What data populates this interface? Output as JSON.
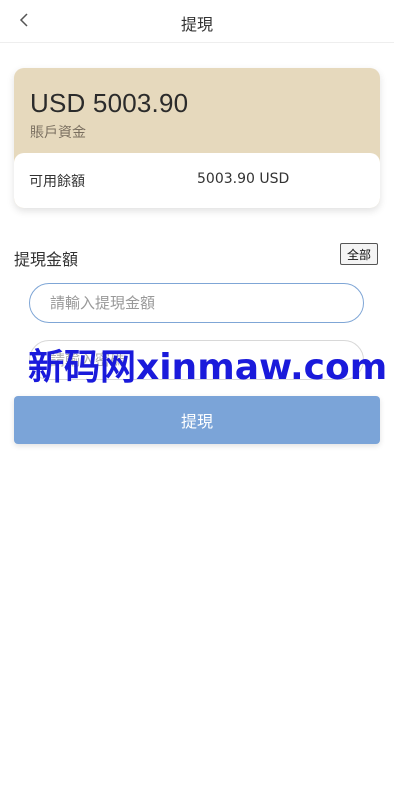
{
  "header": {
    "title": "提現",
    "back_icon": "chevron-left-icon"
  },
  "balance": {
    "amount": "USD 5003.90",
    "label": "賬戶資金",
    "available_label": "可用餘額",
    "available_value": "5003.90 USD",
    "card_color": "#e6d9bd"
  },
  "withdraw": {
    "section_title": "提現金額",
    "all_button": "全部",
    "amount_placeholder": "請輸入提現金額",
    "password_placeholder": "請輸入密碼",
    "submit_label": "提現",
    "submit_color": "#7ba4d8"
  },
  "watermark": {
    "text": "新码网xinmaw.com"
  }
}
